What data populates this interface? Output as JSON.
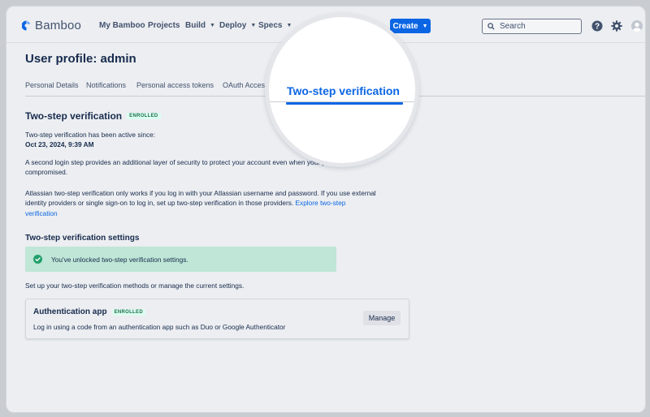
{
  "nav": {
    "brand": "Bamboo",
    "items": [
      {
        "label": "My Bamboo",
        "dropdown": false
      },
      {
        "label": "Projects",
        "dropdown": false
      },
      {
        "label": "Build",
        "dropdown": true
      },
      {
        "label": "Deploy",
        "dropdown": true
      },
      {
        "label": "Specs",
        "dropdown": true
      }
    ],
    "create_label": "Create",
    "search_placeholder": "Search"
  },
  "page": {
    "title": "User profile: admin",
    "tabs": [
      "Personal Details",
      "Notifications",
      "Personal access tokens",
      "OAuth Acces"
    ],
    "active_tab": "Two-step verification"
  },
  "section": {
    "title": "Two-step verification",
    "badge": "ENROLLED",
    "active_since_label": "Two-step verification has been active since:",
    "active_since_date": "Oct 23, 2024, 9:39 AM",
    "para1_line1": "A second login step provides an additional layer of security to protect your account even when your password is",
    "para1_line2": "compromised.",
    "para2_line1": "Atlassian two-step verification only works if you log in with your Atlassian username and password. If you use external",
    "para2_line2": "identity providers or single sign-on to log in, set up two-step verification in those providers.",
    "para2_link_part1": "Explore two-step",
    "para2_link_part2": "verification"
  },
  "settings": {
    "title": "Two-step verification settings",
    "success_message": "You've unlocked two-step verification settings.",
    "description": "Set up your two-step verification methods or manage the current settings.",
    "auth_app": {
      "title": "Authentication app",
      "badge": "ENROLLED",
      "description": "Log in using a code from an authentication app such as Duo or Google Authenticator",
      "manage_label": "Manage"
    }
  },
  "colors": {
    "primary": "#0c66e4",
    "success_bg": "#bfe6d6",
    "success_icon": "#22a06b",
    "badge_text": "#216e4e"
  }
}
